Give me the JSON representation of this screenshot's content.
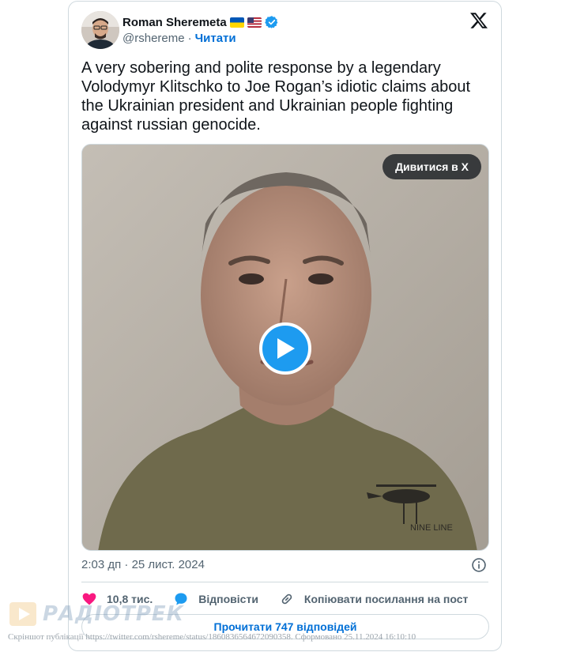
{
  "tweet": {
    "author_name": "Roman Sheremeta",
    "handle": "@rshereme",
    "separator": "·",
    "follow_label": "Читати",
    "text": "A very sobering and polite response by a legendary Volodymyr Klitschko to Joe Rogan’s idiotic claims about the Ukrainian president and Ukrainian people fighting against russian genocide.",
    "watch_label": "Дивитися в X",
    "timestamp": "2:03 дп · 25 лист. 2024",
    "likes": "10,8 тис.",
    "reply_label": "Відповісти",
    "copy_link_label": "Копіювати посилання на пост",
    "read_replies_label": "Прочитати 747 відповідей",
    "shirt_print": "NINE LINE"
  },
  "watermark": {
    "logo_text": "РАДІОТРЕК",
    "caption": "Скріншот публікації https://twitter.com/rshereme/status/1860836564672090358. Сформовано 25.11.2024 16:10:10"
  },
  "colors": {
    "accent": "#1d9bf0",
    "link": "#006fd6",
    "like": "#f91880",
    "muted": "#536471",
    "border": "#cfd9de"
  },
  "icons": [
    "x-logo-icon",
    "verified-badge-icon",
    "info-icon",
    "heart-icon",
    "reply-bubble-icon",
    "link-icon",
    "play-icon"
  ]
}
